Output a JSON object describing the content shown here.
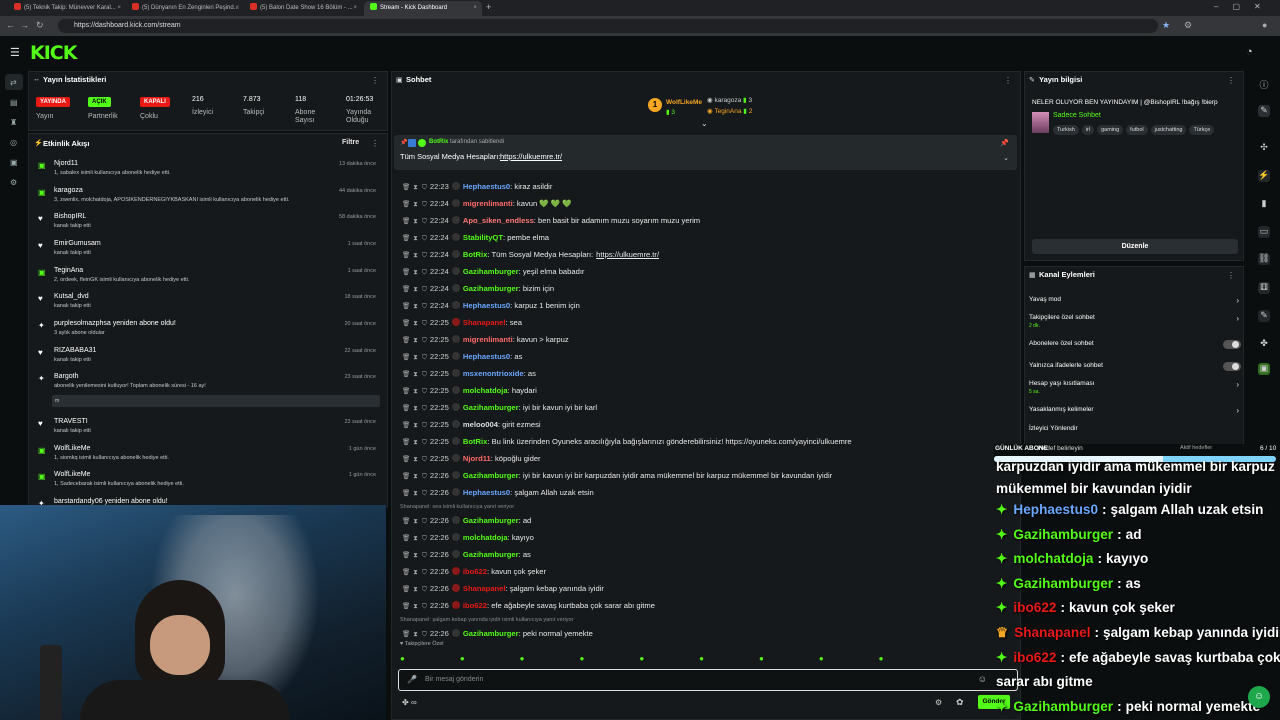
{
  "browser": {
    "tabs": [
      "(5) Teknik Takip: Münevver Karal...",
      "(5) Dünyanın En Zenginleri Peşind...",
      "(5) Balon Date Show 16 Bölüm - ...",
      "Stream - Kick Dashboard"
    ],
    "url": "https://dashboard.kick.com/stream",
    "new_tab": "+"
  },
  "brand": {
    "logo": "KICK",
    "accent": "#53fc18",
    "live_color": "#e91916"
  },
  "stats": {
    "title": "Yayın İstatistikleri",
    "items": [
      {
        "value": "YAYINDA",
        "label": "Yayın",
        "badge": true,
        "color": "#e91916"
      },
      {
        "value": "AÇIK",
        "label": "Partnerlik",
        "badge": true,
        "color": "#53fc18"
      },
      {
        "value": "KAPALI",
        "label": "Çoklu",
        "badge": true,
        "color": "#e91916"
      },
      {
        "value": "216",
        "label": "İzleyici"
      },
      {
        "value": "7.873",
        "label": "Takipçi"
      },
      {
        "value": "118",
        "label": "Abone Sayısı"
      },
      {
        "value": "01:26:53",
        "label": "Yayında Olduğu"
      }
    ]
  },
  "activity": {
    "title": "Etkinlik Akışı",
    "filter": "Filtre",
    "items": [
      {
        "icon": "gift-icon",
        "name": "Njord11",
        "desc": "1, sabalex isimli kullanıcıya abonelik hediye etti.",
        "time": "13 dakika önce",
        "hl": "1, sabalex"
      },
      {
        "icon": "gift-icon",
        "name": "karagoza",
        "desc": "3, zwenlix, molchatdoja, APOSIKENDERNEGIYKBASKANI isimli kullanıcıya abonelik hediye etti.",
        "time": "44 dakika önce"
      },
      {
        "icon": "heart-icon",
        "name": "BishopIRL",
        "desc": "kanalı takip etti",
        "time": "58 dakika önce"
      },
      {
        "icon": "heart-icon",
        "name": "EmirGumusam",
        "desc": "kanalı takip etti",
        "time": "1 saat önce"
      },
      {
        "icon": "gift-icon",
        "name": "TeginAna",
        "desc": "2, ordeek, fleinGK isimli kullanıcıya abonelik hediye etti.",
        "time": "1 saat önce"
      },
      {
        "icon": "heart-icon",
        "name": "Kutsal_dvd",
        "desc": "kanalı takip etti",
        "time": "18 saat önce"
      },
      {
        "icon": "star-icon",
        "name": "purplesolmazphsa yeniden abone oldu!",
        "desc": "3 aylık abone oldular",
        "time": "20 saat önce"
      },
      {
        "icon": "heart-icon",
        "name": "RIZABABA31",
        "desc": "kanalı takip etti",
        "time": "22 saat önce"
      },
      {
        "icon": "star-icon",
        "name": "Bargoth",
        "desc": "abonelik yenilemesini kutluyor! Toplam abonelik süresi - 16 ay!",
        "time": "23 saat önce",
        "extra": "m"
      },
      {
        "icon": "heart-icon",
        "name": "TRAVESTI",
        "desc": "kanalı takip etti",
        "time": "23 saat önce"
      },
      {
        "icon": "gift-icon",
        "name": "WolfLikeMe",
        "desc": "1, siomkq isimli kullanıcıya abonelik hediye etti.",
        "time": "1 gün önce"
      },
      {
        "icon": "gift-icon",
        "name": "WolfLikeMe",
        "desc": "1, Sadecebarak isimli kullanıcıya abonelik hediye etti.",
        "time": "1 gün önce"
      },
      {
        "icon": "star-icon",
        "name": "barstardandy06 yeniden abone oldu!",
        "desc": "",
        "time": ""
      }
    ]
  },
  "chat": {
    "title": "Sohbet",
    "top_gifters": [
      {
        "rank": "1",
        "name": "WolfLikeMe",
        "count": "3"
      },
      {
        "name": "karagoza",
        "count": "3"
      },
      {
        "name": "TeginAna",
        "count": "2"
      }
    ],
    "pinned_by": "BotRix",
    "pinned_by_text": "tarafından sabitlendi",
    "pinned_text": "Tüm Sosyal Medya Hesapları:",
    "pinned_link": "https://ulkuemre.tr/",
    "messages": [
      {
        "time": "22:23",
        "user": "Hephaestus0",
        "color": "#6aa7ff",
        "text": "kiraz asildir"
      },
      {
        "time": "22:24",
        "user": "migrenlimanti",
        "color": "#ff6b6b",
        "text": "kavun 💚 💚 💚"
      },
      {
        "time": "22:24",
        "user": "Apo_siken_endless",
        "color": "#ff7a7a",
        "text": "ben basit bir adamım muzu soyarım muzu yerim"
      },
      {
        "time": "22:24",
        "user": "StabilityQT",
        "color": "#53fc18",
        "text": "pembe elma"
      },
      {
        "time": "22:24",
        "user": "BotRix",
        "color": "#53fc18",
        "text": "Tüm Sosyal Medya Hesapları:",
        "link": "https://ulkuemre.tr/"
      },
      {
        "time": "22:24",
        "user": "Gazihamburger",
        "color": "#53fc18",
        "text": "yeşil elma babadır"
      },
      {
        "time": "22:24",
        "user": "Gazihamburger",
        "color": "#53fc18",
        "text": "bizim için"
      },
      {
        "time": "22:24",
        "user": "Hephaestus0",
        "color": "#6aa7ff",
        "text": "karpuz 1 benim için"
      },
      {
        "time": "22:25",
        "user": "Shanapanel",
        "color": "#e91916",
        "text": "sea"
      },
      {
        "time": "22:25",
        "user": "migrenlimanti",
        "color": "#ff6b6b",
        "text": "kavun > karpuz"
      },
      {
        "time": "22:25",
        "user": "Hephaestus0",
        "color": "#6aa7ff",
        "text": "as"
      },
      {
        "time": "22:25",
        "user": "msxenontrioxide",
        "color": "#6aa7ff",
        "text": "as"
      },
      {
        "time": "22:25",
        "user": "molchatdoja",
        "color": "#53fc18",
        "text": "haydari"
      },
      {
        "time": "22:25",
        "user": "Gazihamburger",
        "color": "#53fc18",
        "text": "iyi bir kavun iyi bir karl"
      },
      {
        "time": "22:25",
        "user": "meloo004",
        "color": "#ddd",
        "text": "girit ezmesi"
      },
      {
        "time": "22:25",
        "user": "BotRix",
        "color": "#53fc18",
        "text": "Bu link üzerinden Oyuneks aracılığıyla bağışlarınızı gönderebilirsiniz! https://oyuneks.com/yayinci/ulkuemre"
      },
      {
        "time": "22:25",
        "user": "Njord11",
        "color": "#ff6b6b",
        "text": "köpoğlu gider"
      },
      {
        "time": "22:26",
        "user": "Gazihamburger",
        "color": "#53fc18",
        "text": "iyi bir kavun iyi bir karpuzdan iyidir ama mükemmel bir karpuz mükemmel bir kavundan iyidir"
      },
      {
        "time": "22:26",
        "user": "Hephaestus0",
        "color": "#6aa7ff",
        "text": "şalgam Allah uzak etsin"
      },
      {
        "reply": "Shanapanel: sea isimli kullanıcıya yanıt veriyor"
      },
      {
        "time": "22:26",
        "user": "Gazihamburger",
        "color": "#53fc18",
        "text": "ad"
      },
      {
        "time": "22:26",
        "user": "molchatdoja",
        "color": "#53fc18",
        "text": "kayıyo"
      },
      {
        "time": "22:26",
        "user": "Gazihamburger",
        "color": "#53fc18",
        "text": "as"
      },
      {
        "time": "22:26",
        "user": "ibo622",
        "color": "#e91916",
        "text": "kavun çok şeker"
      },
      {
        "time": "22:26",
        "user": "Shanapanel",
        "color": "#e91916",
        "text": "şalgam kebap yanında iyidir"
      },
      {
        "time": "22:26",
        "user": "ibo622",
        "color": "#e91916",
        "text": "efe ağabeyle savaş kurtbaba çok sarar abı gitme"
      },
      {
        "reply": "Shanapanel: şalgam kebap yanında iyidir isimli kullanıcıya yanıt veriyor"
      },
      {
        "time": "22:26",
        "user": "Gazihamburger",
        "color": "#53fc18",
        "text": "peki normal yemekte"
      }
    ],
    "followers_only": "Takipçilere Özel",
    "input_placeholder": "Bir mesaj gönderin",
    "send": "Gönder",
    "infinity": "∞"
  },
  "info": {
    "title": "Yayın bilgisi",
    "stream_title": "NELER OLUYOR BEN YAYINDAYIM | @BishopIRL !bağış !bierp",
    "category": "Sadece Sohbet",
    "tags": [
      "Turkish",
      "irl",
      "gaming",
      "futbol",
      "justchatting",
      "Türkçe"
    ],
    "edit": "Düzenle"
  },
  "actions": {
    "title": "Kanal Eylemleri",
    "items": [
      {
        "label": "Yavaş mod",
        "type": "chevron"
      },
      {
        "label": "Takipçilere özel sohbet",
        "sub": "2 dk.",
        "type": "chevron"
      },
      {
        "label": "Abonelere özel sohbet",
        "type": "toggle"
      },
      {
        "label": "Yalnızca ifadelerle sohbet",
        "type": "toggle"
      },
      {
        "label": "Hesap yaşı kısıtlaması",
        "sub": "5 sa.",
        "type": "chevron"
      },
      {
        "label": "Yasaklanmış kelimeler",
        "type": "chevron"
      },
      {
        "label": "İzleyici Yönlendir",
        "type": "none"
      }
    ]
  },
  "goal": {
    "label": "GÜNLÜK ABONE",
    "sub": "Hedef belirleyin",
    "active": "Aktif hedefler",
    "count": "6 / 10",
    "progress": 0.6
  },
  "overlay": [
    {
      "text": "karpuzdan iyidir ama mükemmel bir karpuz"
    },
    {
      "text": "mükemmel bir kavundan iyidir"
    },
    {
      "user": "Hephaestus0",
      "color": "#6aa7ff",
      "text": "şalgam Allah uzak etsin"
    },
    {
      "user": "Gazihamburger",
      "color": "#53fc18",
      "text": "ad"
    },
    {
      "user": "molchatdoja",
      "color": "#53fc18",
      "text": "kayıyo"
    },
    {
      "user": "Gazihamburger",
      "color": "#53fc18",
      "text": "as"
    },
    {
      "user": "ibo622",
      "color": "#e91916",
      "text": "kavun çok şeker"
    },
    {
      "user": "Shanapanel",
      "color": "#e91916",
      "text": "şalgam kebap yanında iyidir",
      "crown": true
    },
    {
      "user": "ibo622",
      "color": "#e91916",
      "text": "efe ağabeyle savaş kurtbaba çok"
    },
    {
      "text": "sarar abı gitme"
    },
    {
      "user": "Gazihamburger",
      "color": "#53fc18",
      "text": "peki normal yemekte"
    }
  ]
}
